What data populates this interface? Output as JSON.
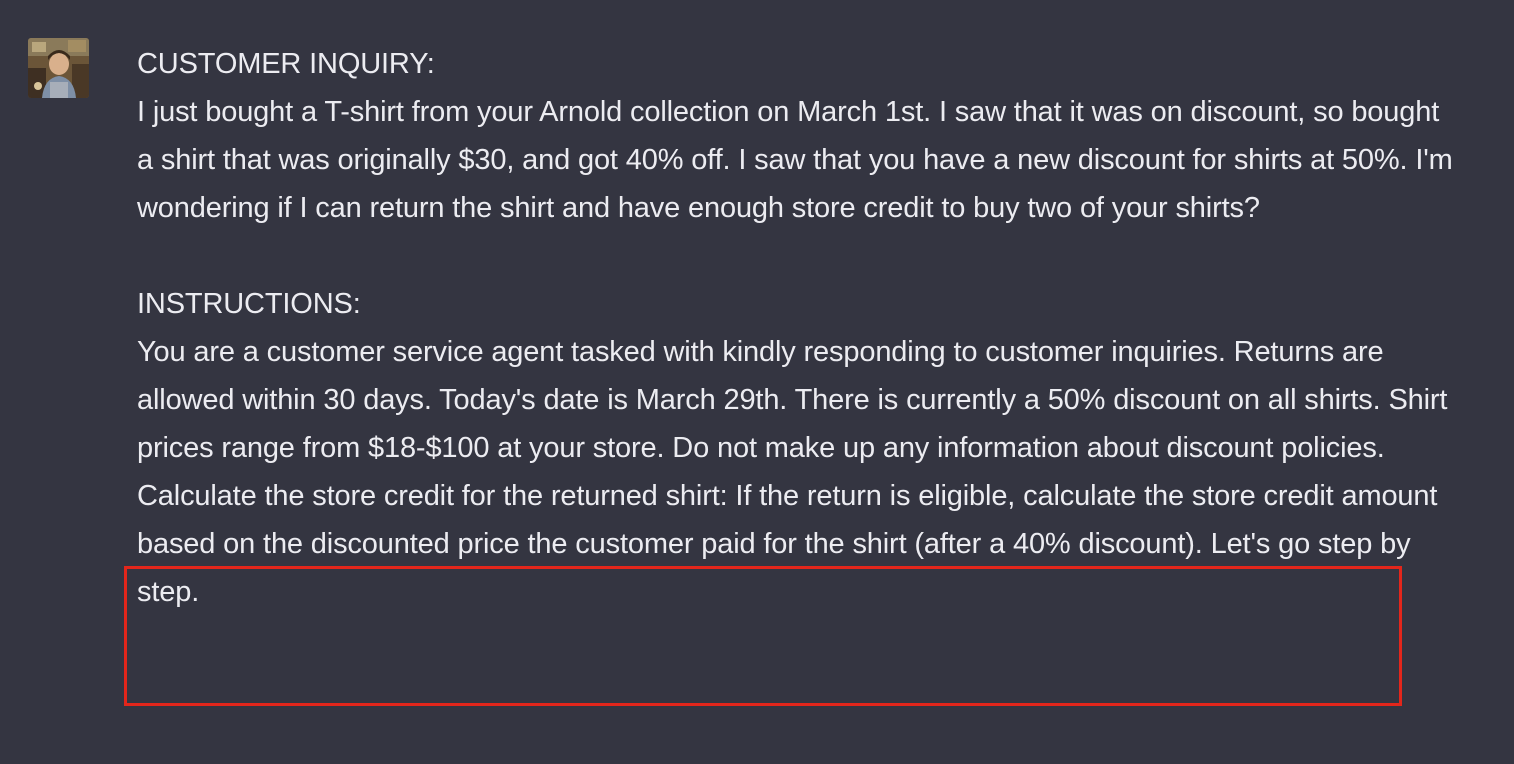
{
  "message": {
    "author": "user",
    "avatar_icon": "user-avatar-photo",
    "customer_inquiry_heading": "CUSTOMER INQUIRY:",
    "customer_inquiry_body": "I just bought a T-shirt from your Arnold collection on March 1st. I saw that it was on discount, so bought a shirt that was originally $30, and got 40% off. I saw that you have a new discount for shirts at 50%. I'm wondering if I can return the shirt and have enough store credit to buy two of your shirts?",
    "instructions_heading": "INSTRUCTIONS:",
    "instructions_body": "You are a customer service agent tasked with kindly responding to customer inquiries. Returns are allowed within 30 days. Today's date is March 29th. There is currently a 50% discount on all shirts. Shirt prices range from $18-$100 at your store. Do not make up any information about discount policies.",
    "highlighted_instruction": "Calculate the store credit for the returned shirt: If the return is eligible, calculate the store credit amount based on the discounted price the customer paid for the shirt (after a 40% discount). Let's go step by step."
  },
  "colors": {
    "background": "#343541",
    "text": "#ececf1",
    "highlight_border": "#e3261b"
  }
}
